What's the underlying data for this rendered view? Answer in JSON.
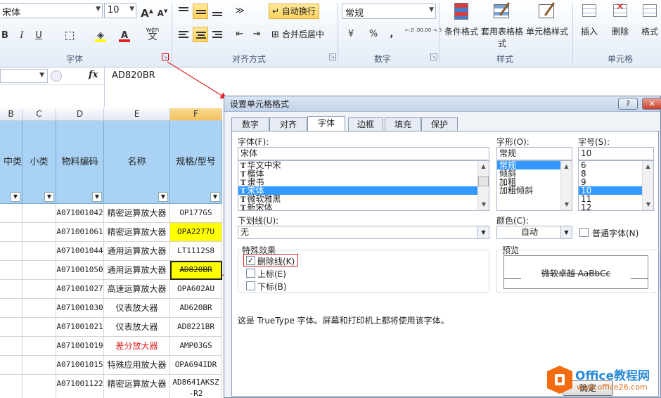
{
  "ribbon": {
    "font_name": "宋体",
    "font_size": "10",
    "bold": "B",
    "italic": "I",
    "underline": "U",
    "wrap_label": "自动换行",
    "merge_label": "合并后居中",
    "number_format": "常规",
    "percent": "%",
    "comma": ",",
    "dec_inc": "←.0 .00",
    "dec_dec": ".00 →.0",
    "phonetic": "wén",
    "cond_format": "条件格式",
    "table_format": "套用表格格式",
    "cell_style": "单元格样式",
    "insert": "插入",
    "delete": "删除",
    "format": "格式",
    "groups": {
      "font": "字体",
      "align": "对齐方式",
      "number": "数字",
      "style": "样式",
      "cells": "单元格"
    }
  },
  "formula_bar": {
    "fx": "fx",
    "content": "AD820BR"
  },
  "grid": {
    "columns": [
      "B",
      "C",
      "D",
      "E",
      "F"
    ],
    "headers": [
      "中类",
      "小类",
      "物料编码",
      "名称",
      "规格/型号"
    ],
    "rows": [
      {
        "code": "A071001042",
        "name": "精密运算放大器",
        "model": "OP177GS"
      },
      {
        "code": "A071001061",
        "name": "精密运算放大器",
        "model": "OPA2277U"
      },
      {
        "code": "A071001044",
        "name": "通用运算放大器",
        "model": "LT1112S8"
      },
      {
        "code": "A071001050",
        "name": "通用运算放大器",
        "model": "AD820BR"
      },
      {
        "code": "A071001027",
        "name": "高速运算放大器",
        "model": "OPA602AU"
      },
      {
        "code": "A071001030",
        "name": "仪表放大器",
        "model": "AD620BR"
      },
      {
        "code": "A071001021",
        "name": "仪表放大器",
        "model": "AD8221BR"
      },
      {
        "code": "A071001019",
        "name": "差分放大器",
        "model": "AMP03GS"
      },
      {
        "code": "A071001015",
        "name": "特殊应用放大器",
        "model": "OPA694IDR"
      },
      {
        "code": "A071001122",
        "name": "精密运算放大器",
        "model": "AD8641AKSZ",
        "model2": "-R2"
      }
    ]
  },
  "dialog": {
    "title": "设置单元格格式",
    "help_btn": "?",
    "close_btn": "✕",
    "tabs": [
      "数字",
      "对齐",
      "字体",
      "边框",
      "填充",
      "保护"
    ],
    "font_label": "字体(F):",
    "font_value": "宋体",
    "font_list": [
      "华文中宋",
      "楷体",
      "隶书",
      "宋体",
      "微软雅黑",
      "新宋体"
    ],
    "font_icon": "T",
    "style_label": "字形(O):",
    "style_value": "常规",
    "style_list": [
      "常规",
      "倾斜",
      "加粗",
      "加粗倾斜"
    ],
    "size_label": "字号(S):",
    "size_value": "10",
    "size_list": [
      "6",
      "8",
      "9",
      "10",
      "11",
      "12"
    ],
    "underline_label": "下划线(U):",
    "underline_value": "无",
    "color_label": "颜色(C):",
    "color_value": "自动",
    "normal_font_label": "普通字体(N)",
    "effects_label": "特殊效果",
    "strike_label": "删除线(K)",
    "super_label": "上标(E)",
    "sub_label": "下标(B)",
    "check_mark": "✓",
    "preview_label": "预览",
    "preview_text": "微软卓越  AaBbCc",
    "note": "这是 TrueType 字体。屏幕和打印机上都将使用该字体。",
    "bottom_partial": "确定"
  },
  "logo": {
    "name": "Office教程网",
    "url": "www.office26.com"
  }
}
